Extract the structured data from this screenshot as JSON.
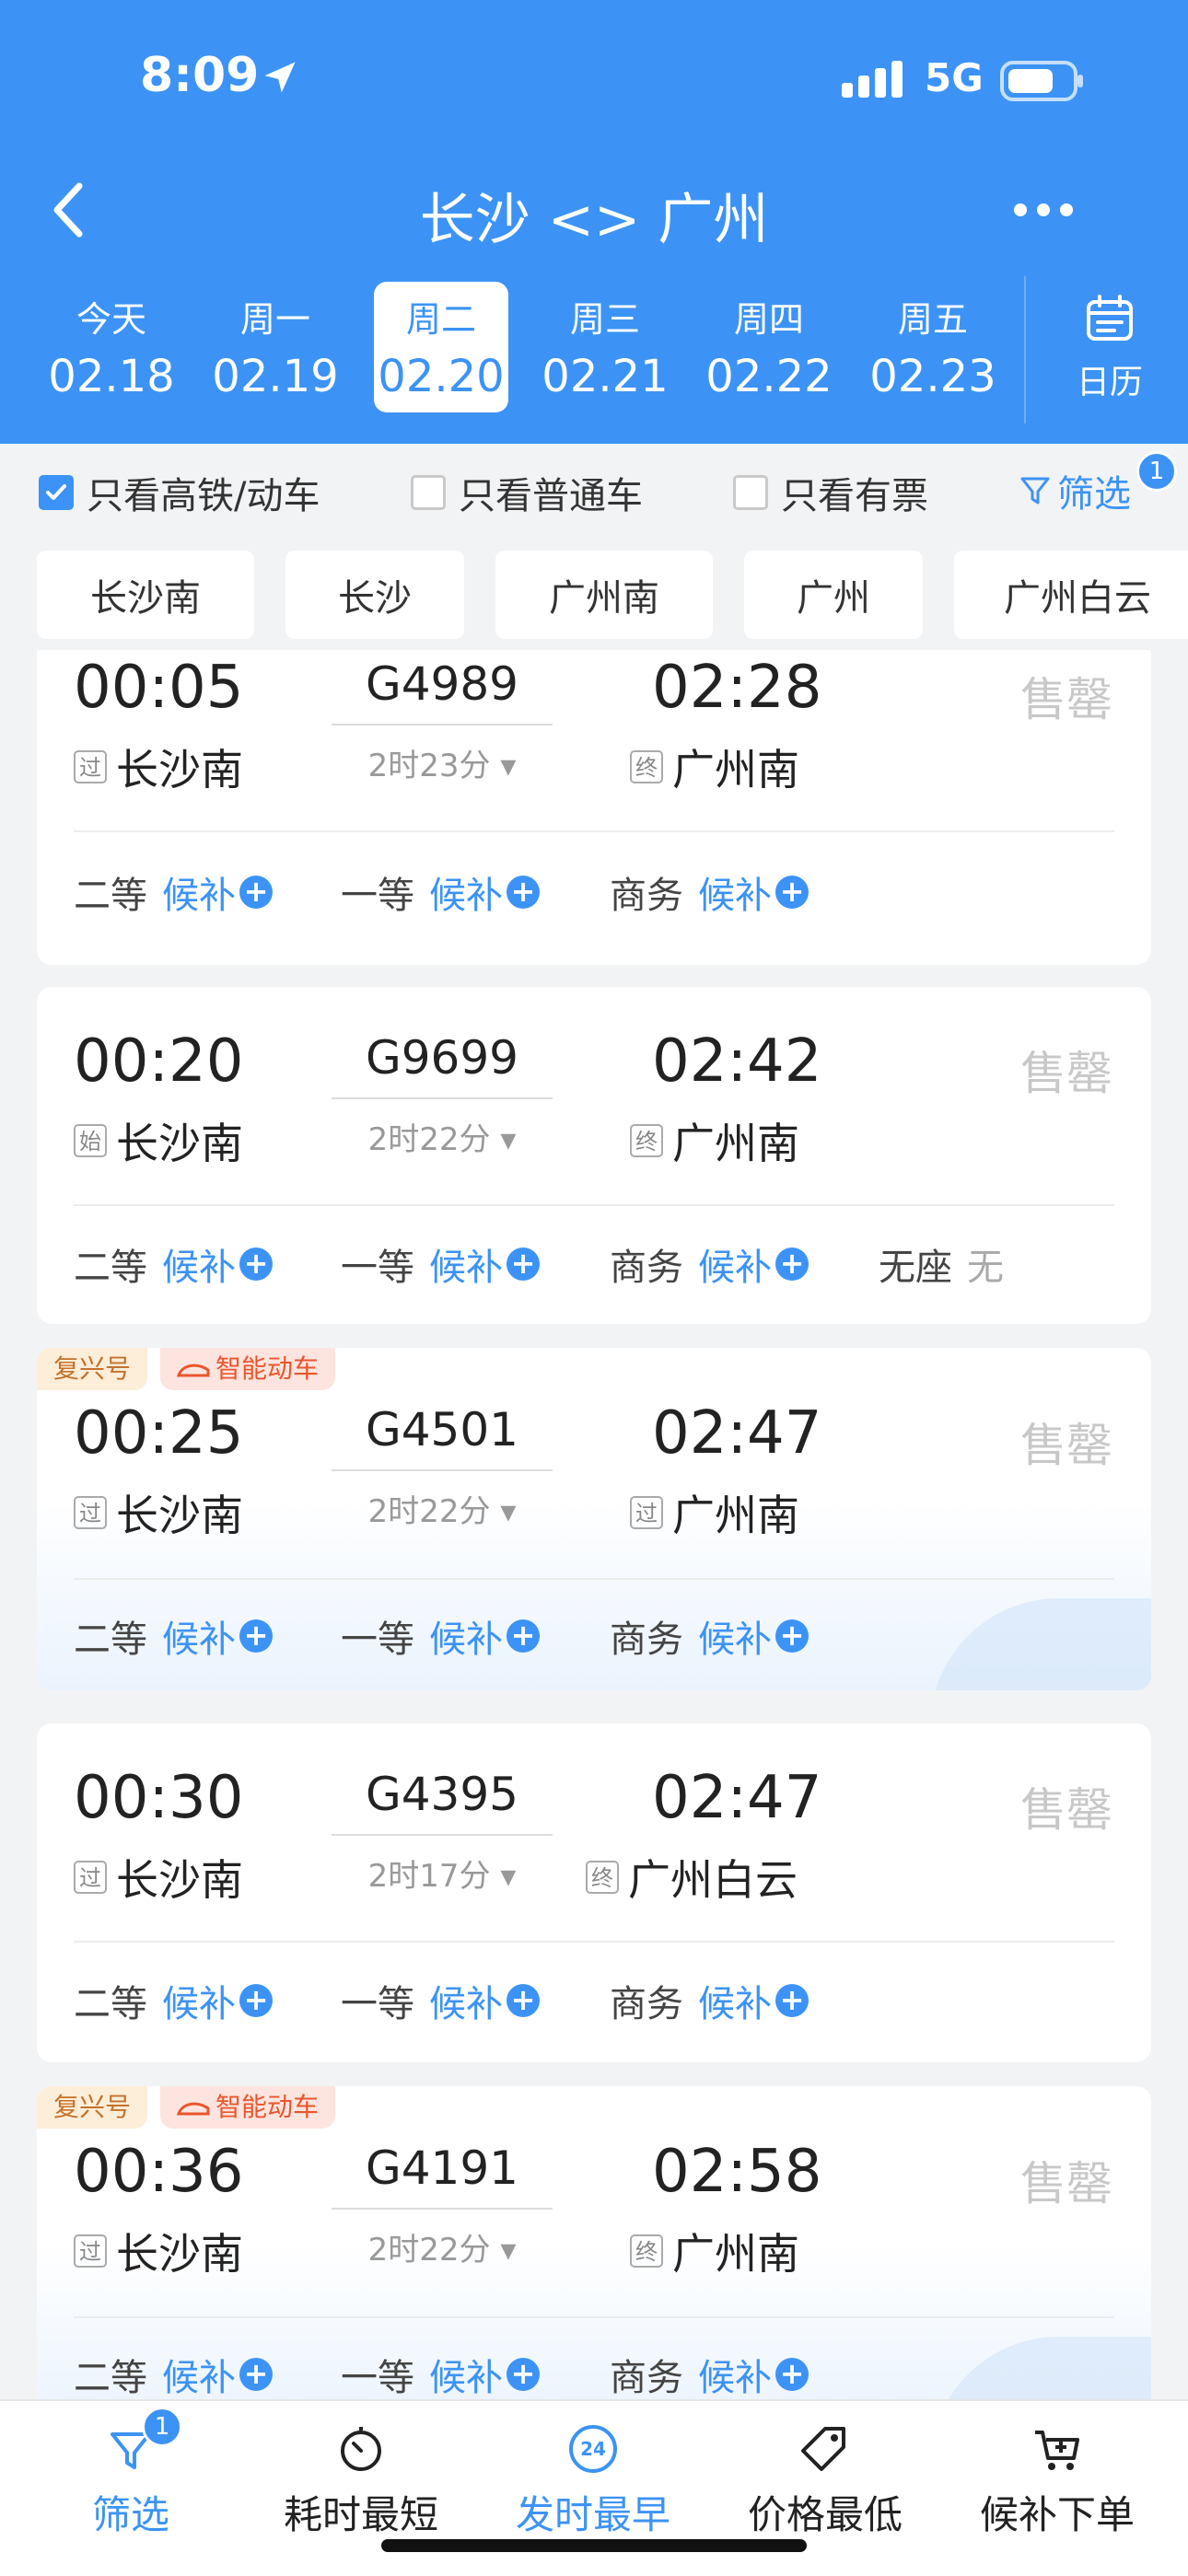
{
  "status_bar": {
    "time": "8:09",
    "network": "5G"
  },
  "header": {
    "title": "长沙 <> 广州"
  },
  "dates": [
    {
      "dow": "今天",
      "date": "02.18"
    },
    {
      "dow": "周一",
      "date": "02.19"
    },
    {
      "dow": "周二",
      "date": "02.20"
    },
    {
      "dow": "周三",
      "date": "02.21"
    },
    {
      "dow": "周四",
      "date": "02.22"
    },
    {
      "dow": "周五",
      "date": "02.23"
    }
  ],
  "calendar_label": "日历",
  "filters": {
    "high_speed": "只看高铁/动车",
    "normal": "只看普通车",
    "available": "只看有票",
    "screen": "筛选",
    "screen_badge": "1"
  },
  "stations": [
    "长沙南",
    "长沙",
    "广州南",
    "广州",
    "广州白云"
  ],
  "trains": [
    {
      "dep_time": "00:05",
      "train_no": "G4989",
      "arr_time": "02:28",
      "duration": "2时23分",
      "from_mark": "过",
      "from": "长沙南",
      "to_mark": "终",
      "to": "广州南",
      "status": "售罄",
      "seats": [
        {
          "cls": "二等",
          "val": "候补"
        },
        {
          "cls": "一等",
          "val": "候补"
        },
        {
          "cls": "商务",
          "val": "候补"
        }
      ]
    },
    {
      "dep_time": "00:20",
      "train_no": "G9699",
      "arr_time": "02:42",
      "duration": "2时22分",
      "from_mark": "始",
      "from": "长沙南",
      "to_mark": "终",
      "to": "广州南",
      "status": "售罄",
      "seats": [
        {
          "cls": "二等",
          "val": "候补"
        },
        {
          "cls": "一等",
          "val": "候补"
        },
        {
          "cls": "商务",
          "val": "候补"
        },
        {
          "cls": "无座",
          "val": "无"
        }
      ]
    },
    {
      "tags": [
        "复兴号",
        "智能动车"
      ],
      "dep_time": "00:25",
      "train_no": "G4501",
      "arr_time": "02:47",
      "duration": "2时22分",
      "from_mark": "过",
      "from": "长沙南",
      "to_mark": "过",
      "to": "广州南",
      "status": "售罄",
      "seats": [
        {
          "cls": "二等",
          "val": "候补"
        },
        {
          "cls": "一等",
          "val": "候补"
        },
        {
          "cls": "商务",
          "val": "候补"
        }
      ]
    },
    {
      "dep_time": "00:30",
      "train_no": "G4395",
      "arr_time": "02:47",
      "duration": "2时17分",
      "from_mark": "过",
      "from": "长沙南",
      "to_mark": "终",
      "to": "广州白云",
      "status": "售罄",
      "seats": [
        {
          "cls": "二等",
          "val": "候补"
        },
        {
          "cls": "一等",
          "val": "候补"
        },
        {
          "cls": "商务",
          "val": "候补"
        }
      ]
    },
    {
      "tags": [
        "复兴号",
        "智能动车"
      ],
      "dep_time": "00:36",
      "train_no": "G4191",
      "arr_time": "02:58",
      "duration": "2时22分",
      "from_mark": "过",
      "from": "长沙南",
      "to_mark": "终",
      "to": "广州南",
      "status": "售罄",
      "seats": [
        {
          "cls": "二等",
          "val": "候补"
        },
        {
          "cls": "一等",
          "val": "候补"
        },
        {
          "cls": "商务",
          "val": "候补"
        }
      ]
    }
  ],
  "bottom_bar": [
    {
      "label": "筛选",
      "icon": "filter-icon",
      "badge": "1"
    },
    {
      "label": "耗时最短",
      "icon": "timer-icon"
    },
    {
      "label": "发时最早",
      "icon": "clock-24-icon"
    },
    {
      "label": "价格最低",
      "icon": "price-tag-icon"
    },
    {
      "label": "候补下单",
      "icon": "cart-plus-icon"
    }
  ],
  "colors": {
    "primary": "#3c93f5",
    "soldout": "#c8c8c8"
  }
}
